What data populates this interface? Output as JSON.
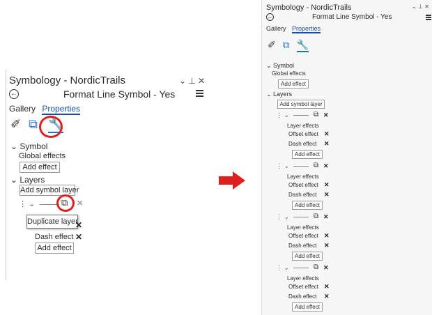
{
  "window": {
    "title": "Symbology - NordicTrails",
    "controls": "⌄ ⊥ ✕",
    "back_icon": "back-circle-arrow-icon",
    "subtitle": "Format Line Symbol - Yes",
    "menu_icon": "hamburger-menu-icon"
  },
  "tabs": {
    "gallery": "Gallery",
    "properties": "Properties"
  },
  "panel_icons": {
    "symbol": "paintbrush-icon",
    "layers": "layers-stack-icon",
    "properties": "wrench-icon"
  },
  "symbol_section": {
    "heading": "Symbol",
    "global_effects": "Global effects",
    "add_effect": "Add effect"
  },
  "layers_section": {
    "heading": "Layers",
    "add_symbol_layer": "Add symbol layer"
  },
  "layer_block": {
    "layer_effects": "Layer effects",
    "offset_effect": "Offset effect",
    "dash_effect": "Dash effect",
    "add_effect": "Add effect"
  },
  "left_layer": {
    "dash_effect": "Dash effect",
    "add_effect": "Add effect",
    "tooltip": "Duplicate layer"
  },
  "annotation_color": "#e02020"
}
